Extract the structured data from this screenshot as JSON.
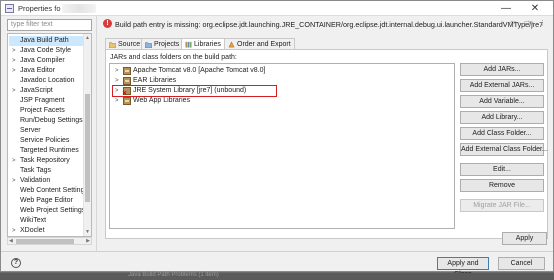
{
  "window": {
    "title": "Properties fo",
    "minimize_glyph": "—",
    "close_glyph": "✕"
  },
  "filter": {
    "placeholder": "type filter text"
  },
  "tree": {
    "items": [
      {
        "label": "Java Build Path",
        "selected": true,
        "expandable": false
      },
      {
        "label": "Java Code Style",
        "expandable": true
      },
      {
        "label": "Java Compiler",
        "expandable": true
      },
      {
        "label": "Java Editor",
        "expandable": true
      },
      {
        "label": "Javadoc Location",
        "expandable": false
      },
      {
        "label": "JavaScript",
        "expandable": true
      },
      {
        "label": "JSP Fragment",
        "expandable": false
      },
      {
        "label": "Project Facets",
        "expandable": false
      },
      {
        "label": "Run/Debug Settings",
        "expandable": false
      },
      {
        "label": "Server",
        "expandable": false
      },
      {
        "label": "Service Policies",
        "expandable": false
      },
      {
        "label": "Targeted Runtimes",
        "expandable": false
      },
      {
        "label": "Task Repository",
        "expandable": true
      },
      {
        "label": "Task Tags",
        "expandable": false
      },
      {
        "label": "Validation",
        "expandable": true
      },
      {
        "label": "Web Content Settings",
        "expandable": false
      },
      {
        "label": "Web Page Editor",
        "expandable": false
      },
      {
        "label": "Web Project Settings",
        "expandable": false
      },
      {
        "label": "WikiText",
        "expandable": false
      },
      {
        "label": "XDoclet",
        "expandable": true
      }
    ]
  },
  "message": {
    "text": "Build path entry is missing: org.eclipse.jdt.launching.JRE_CONTAINER/org.eclipse.jdt.internal.debug.ui.launcher.StandardVMType/jre7",
    "icon": "error-icon"
  },
  "nav": {
    "back": "⇦",
    "forward": "⇨",
    "dropdown": "▾",
    "menu": "⋮"
  },
  "tabs": [
    {
      "label": "Source",
      "icon": "source-folder-icon"
    },
    {
      "label": "Projects",
      "icon": "projects-icon"
    },
    {
      "label": "Libraries",
      "icon": "libraries-icon",
      "active": true
    },
    {
      "label": "Order and Export",
      "icon": "order-export-icon"
    }
  ],
  "panel": {
    "label": "JARs and class folders on the build path:"
  },
  "libraries": [
    {
      "label": "Apache Tomcat v8.0 [Apache Tomcat v8.0]",
      "icon": "library-jar-icon"
    },
    {
      "label": "EAR Libraries",
      "icon": "library-jar-icon"
    },
    {
      "label": "JRE System Library [jre7] (unbound)",
      "icon": "library-error-icon",
      "highlighted": true
    },
    {
      "label": "Web App Libraries",
      "icon": "library-jar-icon"
    }
  ],
  "buttons": {
    "add_jars": "Add JARs...",
    "add_external_jars": "Add External JARs...",
    "add_variable": "Add Variable...",
    "add_library": "Add Library...",
    "add_class_folder": "Add Class Folder...",
    "add_external_class_folder": "Add External Class Folder...",
    "edit": "Edit...",
    "remove": "Remove",
    "migrate_jar": "Migrate JAR File...",
    "apply": "Apply",
    "apply_and_close": "Apply and Close",
    "cancel": "Cancel"
  },
  "help": {
    "glyph": "?"
  },
  "background": {
    "text": "Java Build Path Problems (1 item)"
  },
  "colors": {
    "selection": "#cce8ff",
    "error": "#d93b3b",
    "highlight_box": "#d42020"
  }
}
